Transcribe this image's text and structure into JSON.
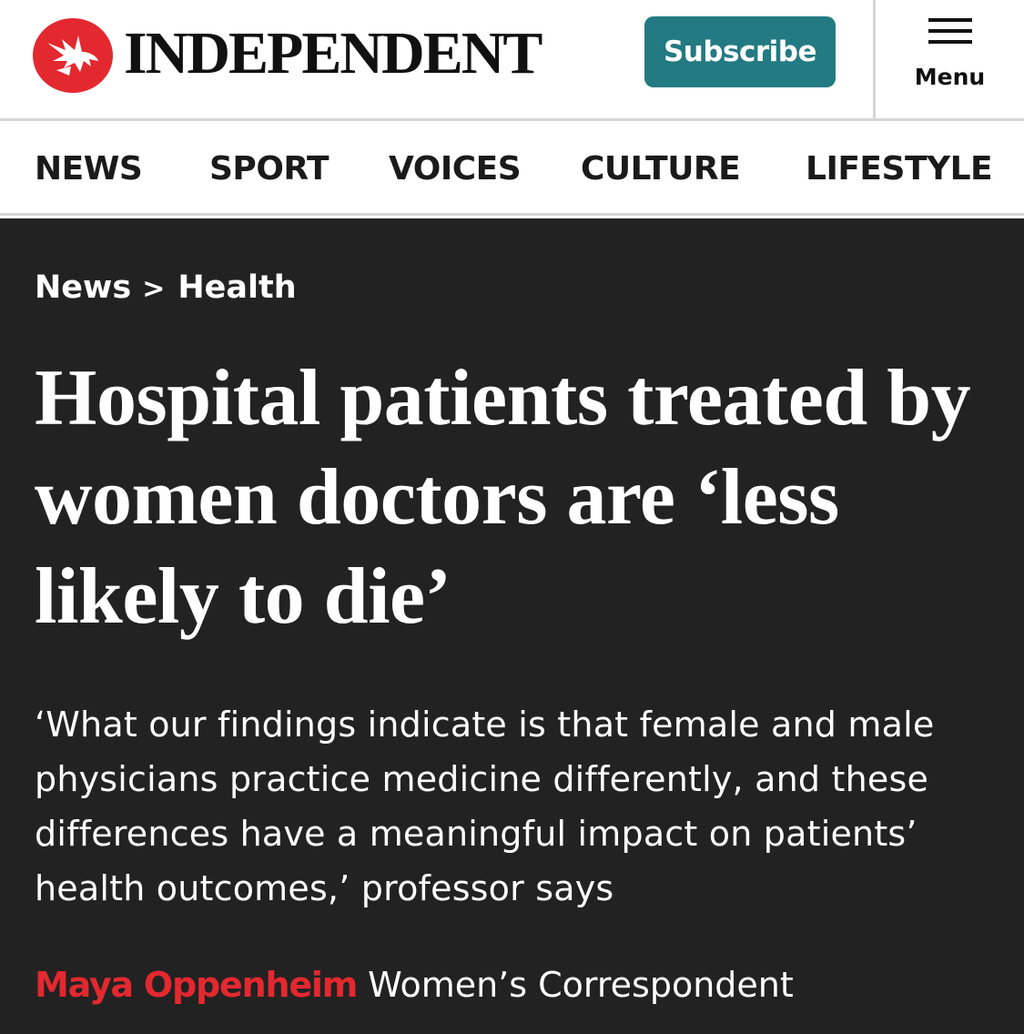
{
  "header": {
    "logo_text": "INDEPENDENT",
    "logo_icon": "eagle-icon",
    "subscribe_label": "Subscribe",
    "menu_label": "Menu",
    "menu_icon": "hamburger-menu-icon",
    "colors": {
      "logo_red": "#e4282f",
      "subscribe_teal": "#237a82"
    }
  },
  "nav": {
    "items": [
      {
        "label": "NEWS"
      },
      {
        "label": "SPORT"
      },
      {
        "label": "VOICES"
      },
      {
        "label": "CULTURE"
      },
      {
        "label": "LIFESTYLE"
      }
    ]
  },
  "article": {
    "breadcrumb": {
      "section": "News",
      "separator": ">",
      "subsection": "Health"
    },
    "headline": "Hospital patients treated by women doctors are ‘less likely to die’",
    "standfirst": "‘What our findings indicate is that female and male physicians practice medicine differently, and these differences have a meaningful impact on patients’ health outcomes,’ professor says",
    "byline": {
      "author": "Maya Oppenheim",
      "role": "Women’s Correspondent"
    },
    "colors": {
      "background": "#222222",
      "author_red": "#e4282f"
    }
  }
}
